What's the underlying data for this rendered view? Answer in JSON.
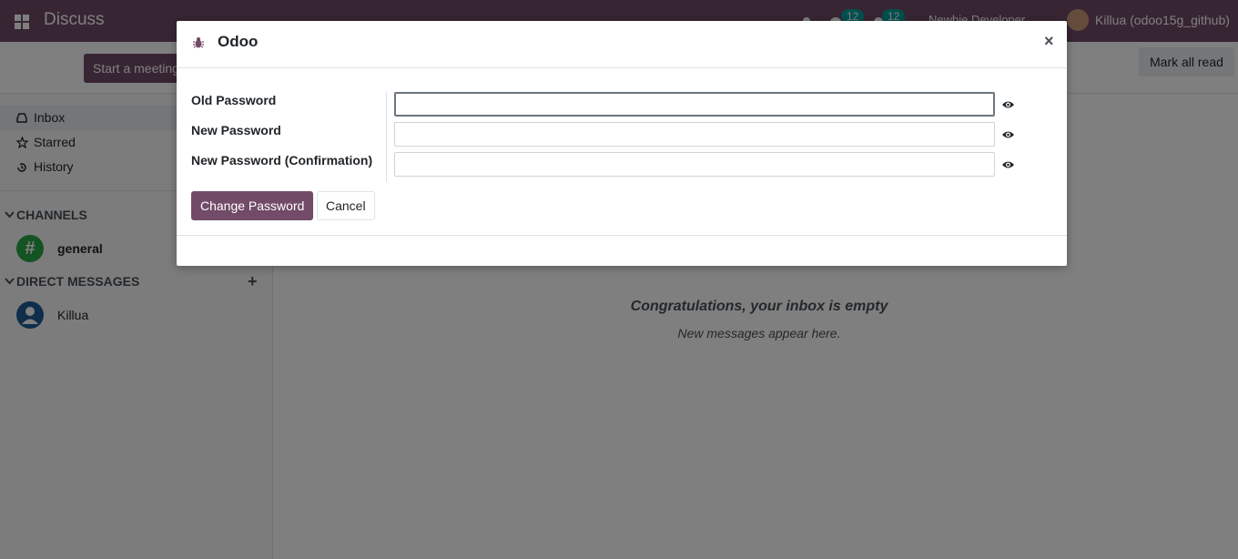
{
  "navbar": {
    "app_title": "Discuss",
    "chat_count": "12",
    "activity_count": "12",
    "company": "Newbie Developer",
    "user_name": "Killua (odoo15g_github)"
  },
  "control_panel": {
    "start_meeting_label": "Start a meeting",
    "mark_all_read_label": "Mark all read"
  },
  "sidebar": {
    "items": [
      {
        "label": "Inbox",
        "icon": "inbox-icon"
      },
      {
        "label": "Starred",
        "icon": "star-icon"
      },
      {
        "label": "History",
        "icon": "history-icon"
      }
    ],
    "channels_header": "CHANNELS",
    "channels": [
      {
        "name": "general",
        "avatar": "#",
        "color": "#28a745"
      }
    ],
    "direct_messages_header": "DIRECT MESSAGES",
    "direct_messages": [
      {
        "name": "Killua",
        "color": "#1f5c99"
      }
    ]
  },
  "main": {
    "empty_title": "Congratulations, your inbox is empty",
    "empty_subtitle": "New messages appear here."
  },
  "dialog": {
    "title": "Odoo",
    "close_symbol": "×",
    "fields": [
      {
        "label": "Old Password",
        "value": ""
      },
      {
        "label": "New Password",
        "value": ""
      },
      {
        "label": "New Password (Confirmation)",
        "value": ""
      }
    ],
    "submit_label": "Change Password",
    "cancel_label": "Cancel"
  },
  "colors": {
    "brand": "#714b67",
    "badge": "#00a09d",
    "backdrop": "rgba(0,0,0,0.5)"
  }
}
